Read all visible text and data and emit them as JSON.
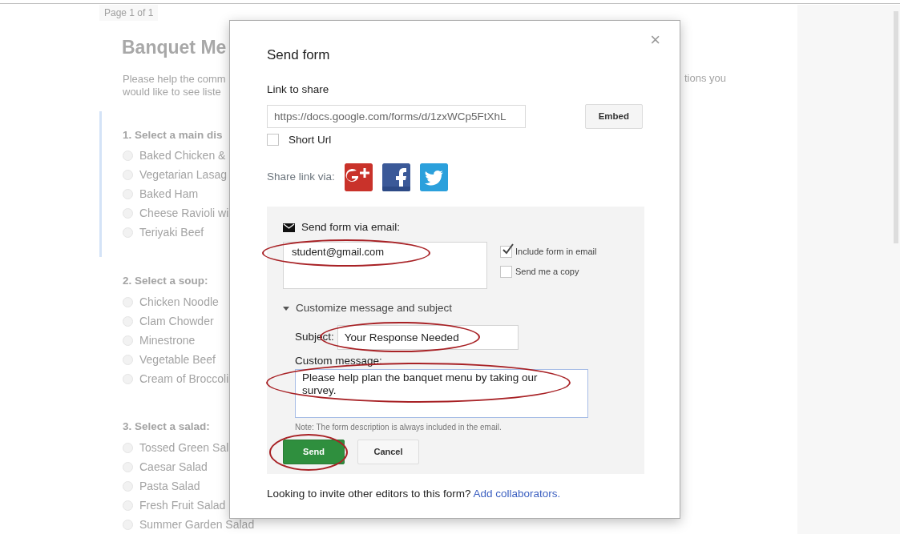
{
  "page": {
    "page_indicator": "Page 1 of 1",
    "title": "Banquet Me",
    "description_lines": [
      "Please help the comm",
      "would like to see liste"
    ],
    "description_tail": "tions you",
    "questions": [
      {
        "title": "1. Select a main dis",
        "focused": true,
        "options": [
          "Baked Chicken &",
          "Vegetarian Lasag",
          "Baked Ham",
          "Cheese Ravioli wi",
          "Teriyaki Beef"
        ]
      },
      {
        "title": "2. Select a soup:",
        "focused": false,
        "options": [
          "Chicken Noodle",
          "Clam Chowder",
          "Minestrone",
          "Vegetable Beef",
          "Cream of Broccoli"
        ]
      },
      {
        "title": "3. Select a salad:",
        "focused": false,
        "options": [
          "Tossed Green Sal",
          "Caesar Salad",
          "Pasta Salad",
          "Fresh Fruit Salad",
          "Summer Garden Salad"
        ]
      }
    ]
  },
  "dialog": {
    "title": "Send form",
    "close": "×",
    "link_label": "Link to share",
    "link_value": "https://docs.google.com/forms/d/1zxWCp5FtXhL",
    "embed_button": "Embed",
    "short_url": {
      "label": "Short Url",
      "checked": false
    },
    "share_label": "Share link via:",
    "email": {
      "heading": "Send form via email:",
      "to": "student@gmail.com",
      "to_circled": true,
      "options": [
        {
          "label": "Include form in email",
          "checked": true
        },
        {
          "label": "Send me a copy",
          "checked": false
        }
      ],
      "customize": {
        "label": "Customize message and subject",
        "expanded": true
      },
      "subject_label": "Subject:",
      "subject": "Your Response Needed",
      "subject_circled": true,
      "message_label": "Custom message:",
      "message": "Please help plan the banquet menu by taking our survey.",
      "message_circled": true,
      "note": "Note: The form description is always included in the email.",
      "send_button": "Send",
      "send_circled": true,
      "cancel_button": "Cancel"
    },
    "footer_text": "Looking to invite other editors to this form?",
    "footer_link": "Add collaborators."
  }
}
